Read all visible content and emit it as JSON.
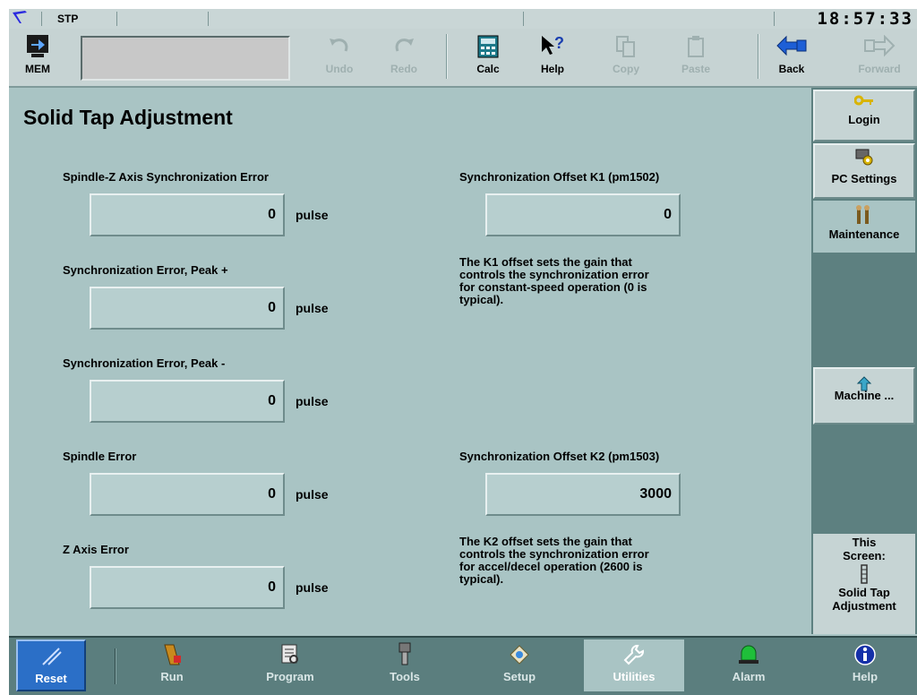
{
  "status": {
    "mode": "STP",
    "time": "18:57:33"
  },
  "toolbar": {
    "mem": "MEM",
    "undo": "Undo",
    "redo": "Redo",
    "calc": "Calc",
    "help": "Help",
    "copy": "Copy",
    "paste": "Paste",
    "back": "Back",
    "forward": "Forward"
  },
  "page": {
    "title": "Solid Tap Adjustment"
  },
  "fields": [
    {
      "label": "Spindle-Z Axis Synchronization Error",
      "value": "0",
      "unit": "pulse"
    },
    {
      "label": "Synchronization Error, Peak +",
      "value": "0",
      "unit": "pulse"
    },
    {
      "label": "Synchronization Error, Peak -",
      "value": "0",
      "unit": "pulse"
    },
    {
      "label": "Spindle Error",
      "value": "0",
      "unit": "pulse"
    },
    {
      "label": "Z Axis Error",
      "value": "0",
      "unit": "pulse"
    }
  ],
  "offsets": [
    {
      "label": "Synchronization Offset K1 (pm1502)",
      "value": "0",
      "desc": [
        "The K1 offset sets the gain that",
        "controls the synchronization error",
        "for constant-speed operation (0 is",
        "typical)."
      ]
    },
    {
      "label": "Synchronization Offset K2 (pm1503)",
      "value": "3000",
      "desc": [
        "The K2 offset sets the gain that",
        "controls the synchronization error",
        "for accel/decel operation (2600 is",
        "typical)."
      ]
    }
  ],
  "sidebar": {
    "login": "Login",
    "pc_settings": "PC Settings",
    "maintenance": "Maintenance",
    "machine": "Machine ...",
    "this_screen_1": "This",
    "this_screen_2": "Screen:",
    "this_screen_3": "Solid Tap",
    "this_screen_4": "Adjustment"
  },
  "nav": {
    "reset": "Reset",
    "run": "Run",
    "program": "Program",
    "tools": "Tools",
    "setup": "Setup",
    "utilities": "Utilities",
    "alarm": "Alarm",
    "help": "Help"
  },
  "colors": {
    "panel": "#a9c4c4",
    "sidebar": "#5d8080",
    "nav": "#5b7e7e",
    "reset": "#2b6fc7"
  }
}
